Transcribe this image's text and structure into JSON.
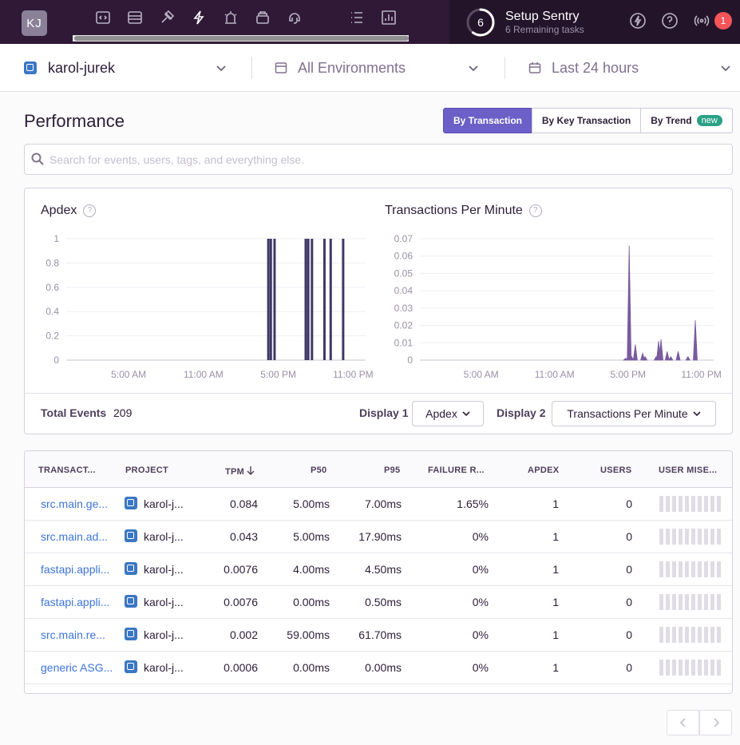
{
  "nav": {
    "avatar_initials": "KJ",
    "icons": [
      "projects-icon",
      "issues-icon",
      "performance-icon",
      "releases-icon",
      "alerts-icon",
      "discover-icon",
      "monitors-icon",
      "dashboards-icon",
      "stats-icon"
    ],
    "setup": {
      "count": "6",
      "title": "Setup Sentry",
      "subtitle": "6 Remaining tasks",
      "progress": 0.6
    },
    "notifications_count": "1"
  },
  "filters": {
    "project": "karol-jurek",
    "environment": "All Environments",
    "period": "Last 24 hours"
  },
  "page": {
    "title": "Performance",
    "views": [
      "By Transaction",
      "By Key Transaction",
      "By Trend"
    ],
    "active_view": "By Transaction",
    "new_badge": "new"
  },
  "search": {
    "placeholder": "Search for events, users, tags, and everything else."
  },
  "charts": {
    "footer": {
      "total_events_label": "Total Events",
      "total_events_value": "209",
      "display1_label": "Display 1",
      "display1_value": "Apdex",
      "display2_label": "Display 2",
      "display2_value": "Transactions Per Minute"
    }
  },
  "chart_data": [
    {
      "type": "bar",
      "title": "Apdex",
      "ylim": [
        0,
        1
      ],
      "y_ticks": [
        "1",
        "0.8",
        "0.6",
        "0.4",
        "0.2",
        "0"
      ],
      "x_ticks": [
        "5:00 AM",
        "11:00 AM",
        "5:00 PM",
        "11:00 PM"
      ],
      "x_range_hours": [
        0,
        24
      ],
      "color": "#3f3965",
      "x": [
        16.2,
        16.4,
        16.7,
        19.2,
        19.4,
        19.7,
        20.7,
        21.2,
        22.2
      ],
      "values": [
        1,
        1,
        1,
        1,
        1,
        1,
        1,
        1,
        1
      ]
    },
    {
      "type": "area",
      "title": "Transactions Per Minute",
      "ylim": [
        0,
        0.07
      ],
      "y_ticks": [
        "0.07",
        "0.06",
        "0.05",
        "0.04",
        "0.03",
        "0.02",
        "0.01",
        "0"
      ],
      "x_ticks": [
        "5:00 AM",
        "11:00 AM",
        "5:00 PM",
        "11:00 PM"
      ],
      "x_range_hours": [
        0,
        24
      ],
      "color": "#7a5b9e",
      "x": [
        16.8,
        17.0,
        17.1,
        17.3,
        17.6,
        18.2,
        18.4,
        19.3,
        19.5,
        19.7,
        20.2,
        20.5,
        21.1,
        21.9,
        22.5
      ],
      "values": [
        0.001,
        0.002,
        0.066,
        0.002,
        0.009,
        0.004,
        0.002,
        0.002,
        0.011,
        0.012,
        0.005,
        0.002,
        0.005,
        0.002,
        0.023
      ]
    }
  ],
  "table": {
    "headers": {
      "transaction": "TRANSACT...",
      "project": "PROJECT",
      "tpm": "TPM",
      "p50": "P50",
      "p95": "P95",
      "failure_rate": "FAILURE R...",
      "apdex": "APDEX",
      "users": "USERS",
      "user_misery": "USER MISE..."
    },
    "rows": [
      {
        "transaction": "src.main.ge...",
        "project": "karol-j...",
        "tpm": "0.084",
        "p50": "5.00ms",
        "p95": "7.00ms",
        "failure_rate": "1.65%",
        "apdex": "1",
        "users": "0"
      },
      {
        "transaction": "src.main.ad...",
        "project": "karol-j...",
        "tpm": "0.043",
        "p50": "5.00ms",
        "p95": "17.90ms",
        "failure_rate": "0%",
        "apdex": "1",
        "users": "0"
      },
      {
        "transaction": "fastapi.appli...",
        "project": "karol-j...",
        "tpm": "0.0076",
        "p50": "4.00ms",
        "p95": "4.50ms",
        "failure_rate": "0%",
        "apdex": "1",
        "users": "0"
      },
      {
        "transaction": "fastapi.appli...",
        "project": "karol-j...",
        "tpm": "0.0076",
        "p50": "0.00ms",
        "p95": "0.50ms",
        "failure_rate": "0%",
        "apdex": "1",
        "users": "0"
      },
      {
        "transaction": "src.main.re...",
        "project": "karol-j...",
        "tpm": "0.002",
        "p50": "59.00ms",
        "p95": "61.70ms",
        "failure_rate": "0%",
        "apdex": "1",
        "users": "0"
      },
      {
        "transaction": "generic ASG...",
        "project": "karol-j...",
        "tpm": "0.0006",
        "p50": "0.00ms",
        "p95": "0.00ms",
        "failure_rate": "0%",
        "apdex": "1",
        "users": "0"
      }
    ]
  }
}
